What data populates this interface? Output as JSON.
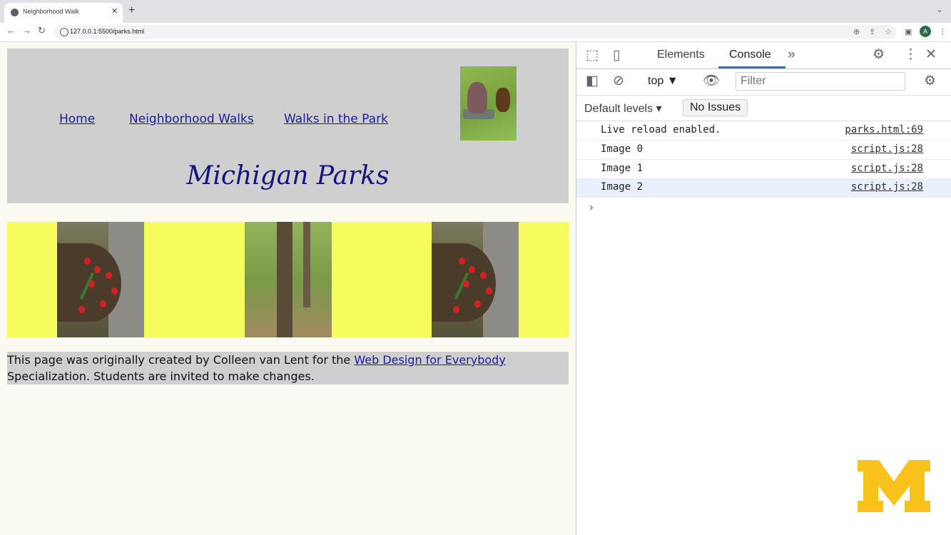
{
  "browser": {
    "tab_title": "Neighborhood Walk",
    "url": "127.0.0.1:5500/parks.html",
    "avatar_letter": "A"
  },
  "page": {
    "nav": [
      "Home",
      "Neighborhood Walks",
      "Walks in the Park"
    ],
    "title": "Michigan Parks",
    "footer_text": "This page was originally created by Colleen van Lent for the",
    "footer_link": "Web Design for Everybody",
    "footer_tail": "Specialization. Students are invited to make changes."
  },
  "devtools": {
    "tabs": [
      "Elements",
      "Console"
    ],
    "context": "top",
    "filter_placeholder": "Filter",
    "levels": "Default levels",
    "issues": "No Issues",
    "logs": [
      {
        "msg": "Live reload enabled.",
        "src": "parks.html:69"
      },
      {
        "msg": "Image 0",
        "src": "script.js:28"
      },
      {
        "msg": "Image 1",
        "src": "script.js:28"
      },
      {
        "msg": "Image 2",
        "src": "script.js:28"
      }
    ]
  },
  "colors": {
    "accent": "#1a73e8",
    "header_gray": "#cfcfcf",
    "gallery_yellow": "#f6fb5e",
    "link_blue": "#1c1c99",
    "logo_maize": "#f7c21a"
  }
}
